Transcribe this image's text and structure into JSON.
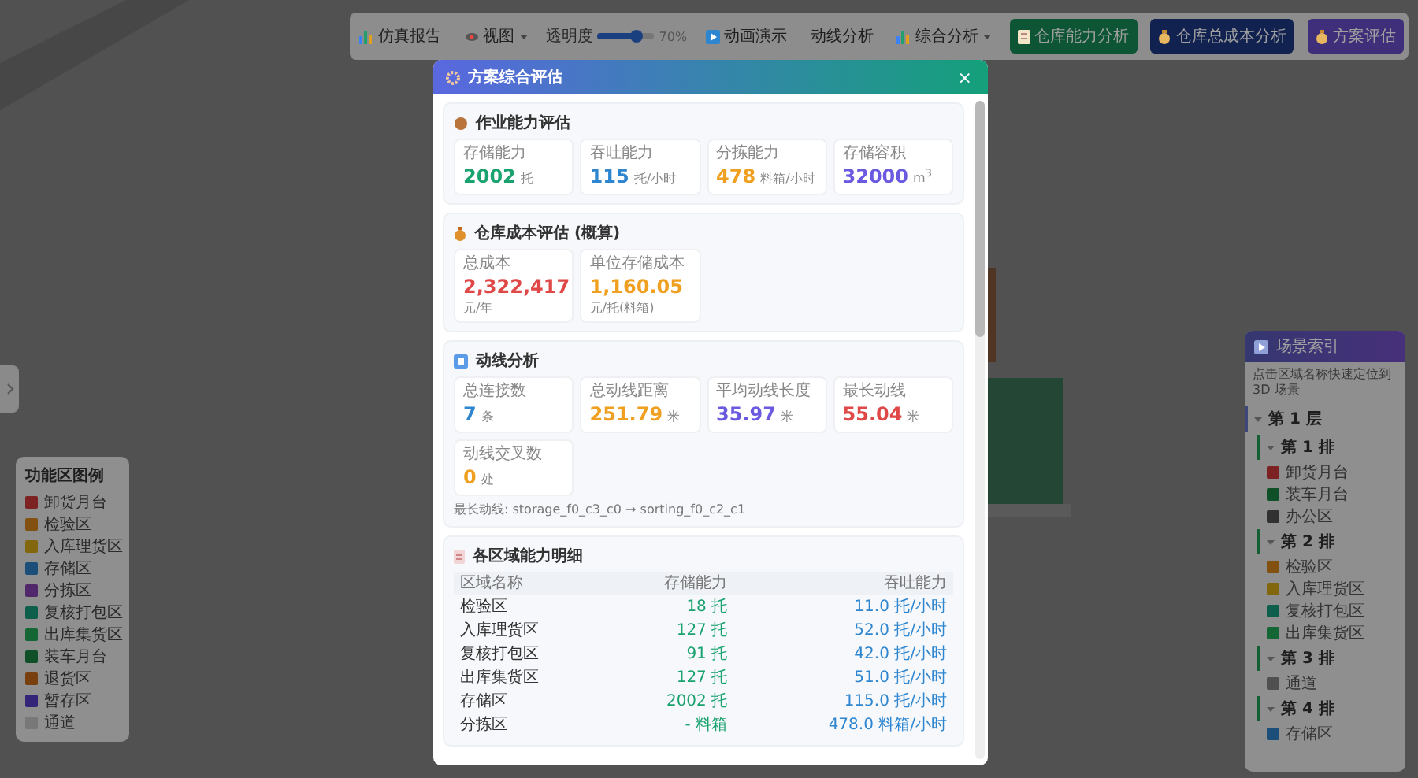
{
  "toolbar": [
    {
      "kind": "button",
      "label": "仿真报告"
    },
    {
      "kind": "dropdown",
      "label": "视图"
    },
    {
      "kind": "slider",
      "label": "透明度",
      "level": 0.7,
      "reading": "70%"
    },
    {
      "kind": "button",
      "label": "动画演示"
    },
    {
      "kind": "button",
      "label": "动线分析"
    },
    {
      "kind": "dropdown",
      "label": "综合分析"
    },
    {
      "kind": "primary",
      "label": "仓库能力分析",
      "color": "#0d5534"
    },
    {
      "kind": "primary",
      "label": "仓库总成本分析",
      "color": "#112250"
    },
    {
      "kind": "primary",
      "label": "方案评估",
      "color": "#3f2e79"
    }
  ],
  "legend": {
    "title": "功能区图例",
    "items": [
      {
        "label": "卸货月台",
        "color": "#7d2222"
      },
      {
        "label": "检验区",
        "color": "#825011"
      },
      {
        "label": "入库理货区",
        "color": "#82670f"
      },
      {
        "label": "存储区",
        "color": "#1b4e79"
      },
      {
        "label": "分拣区",
        "color": "#50276b"
      },
      {
        "label": "复核打包区",
        "color": "#0d5f4c"
      },
      {
        "label": "出库集货区",
        "color": "#146634"
      },
      {
        "label": "装车月台",
        "color": "#105028"
      },
      {
        "label": "退货区",
        "color": "#783f0f"
      },
      {
        "label": "暂存区",
        "color": "#342579"
      },
      {
        "label": "通道",
        "color": "#787878"
      }
    ]
  },
  "scene_index": {
    "title": "场景索引",
    "hint": "点击区域名称快速定位到 3D 场景",
    "floors": [
      {
        "label": "第 1 层",
        "expanded": true,
        "children": [
          {
            "label": "第 1 排",
            "expanded": true,
            "children": [
              {
                "label": "卸货月台",
                "color": "#7d2222"
              },
              {
                "label": "装车月台",
                "color": "#105028"
              },
              {
                "label": "办公区",
                "color": "#313131"
              }
            ]
          },
          {
            "label": "第 2 排",
            "expanded": true,
            "children": [
              {
                "label": "检验区",
                "color": "#825011"
              },
              {
                "label": "入库理货区",
                "color": "#82670f"
              },
              {
                "label": "复核打包区",
                "color": "#0d5f4c"
              },
              {
                "label": "出库集货区",
                "color": "#146634"
              }
            ]
          },
          {
            "label": "第 3 排",
            "expanded": true,
            "children": [
              {
                "label": "通道",
                "color": "#505050"
              }
            ]
          },
          {
            "label": "第 4 排",
            "expanded": true,
            "children": [
              {
                "label": "存储区",
                "color": "#1b4e79"
              }
            ]
          }
        ]
      }
    ]
  },
  "dialog": {
    "title": "方案综合评估",
    "close": "×",
    "sections": [
      {
        "kind": "stats",
        "title": "作业能力评估",
        "stats": [
          {
            "label": "存储能力",
            "value": "2002",
            "unit": "托",
            "color": "#1aa36e"
          },
          {
            "label": "吞吐能力",
            "value": "115",
            "unit": "托/小时",
            "color": "#2e86d0"
          },
          {
            "label": "分拣能力",
            "value": "478",
            "unit": "料箱/小时",
            "color": "#f0a020"
          },
          {
            "label": "存储容积",
            "value": "32000",
            "unit": "m$^{3}$",
            "color": "#6a5ae0"
          }
        ]
      },
      {
        "kind": "stats",
        "title": "仓库成本评估 (概算)",
        "stats": [
          {
            "label": "总成本",
            "value": "2,322,417",
            "unit": "元/年",
            "color": "#e04848"
          },
          {
            "label": "单位存储成本",
            "value": "1,160.05",
            "unit": "元/托(料箱)",
            "color": "#f0a020"
          }
        ]
      },
      {
        "kind": "stats",
        "title": "动线分析",
        "stats": [
          {
            "label": "总连接数",
            "value": "7",
            "unit": "条",
            "color": "#2e86d0"
          },
          {
            "label": "总动线距离",
            "value": "251.79",
            "unit": "米",
            "color": "#f0a020"
          },
          {
            "label": "平均动线长度",
            "value": "35.97",
            "unit": "米",
            "color": "#6a5ae0"
          },
          {
            "label": "最长动线",
            "value": "55.04",
            "unit": "米",
            "color": "#e04848"
          },
          {
            "label": "动线交叉数",
            "value": "0",
            "unit": "处",
            "color": "#f0a020"
          }
        ],
        "note": "最长动线: storage_f0_c3_c0 → sorting_f0_c2_c1"
      },
      {
        "kind": "table",
        "title": "各区域能力明细",
        "columns": [
          "区域名称",
          "存储能力",
          "吞吐能力"
        ],
        "rows": [
          [
            "检验区",
            "18 托",
            "11.0 托/小时"
          ],
          [
            "入库理货区",
            "127 托",
            "52.0 托/小时"
          ],
          [
            "复核打包区",
            "91 托",
            "42.0 托/小时"
          ],
          [
            "出库集货区",
            "127 托",
            "51.0 托/小时"
          ],
          [
            "存储区",
            "2002 托",
            "115.0 托/小时"
          ],
          [
            "分拣区",
            "- 料箱",
            "478.0 料箱/小时"
          ]
        ]
      }
    ]
  }
}
